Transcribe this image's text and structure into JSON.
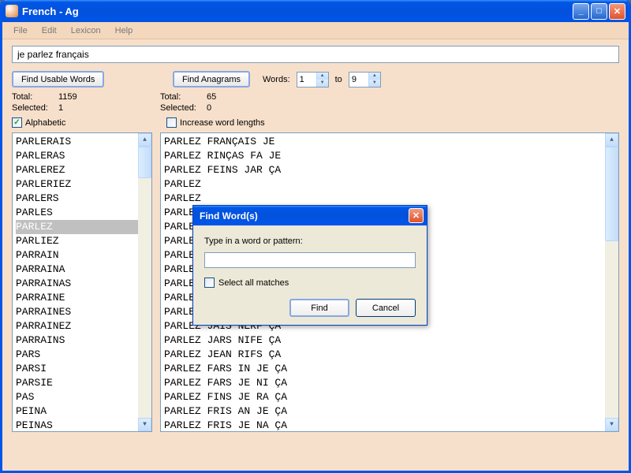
{
  "window": {
    "title": "French - Ag"
  },
  "menu": {
    "file": "File",
    "edit": "Edit",
    "lexicon": "Lexicon",
    "help": "Help"
  },
  "input": {
    "main_value": "je parlez français"
  },
  "buttons": {
    "find_usable": "Find Usable Words",
    "find_anagrams": "Find Anagrams"
  },
  "range": {
    "label": "Words:",
    "from": "1",
    "to_label": "to",
    "to": "9"
  },
  "left_stats": {
    "total_label": "Total:",
    "total": "1159",
    "selected_label": "Selected:",
    "selected": "1"
  },
  "right_stats": {
    "total_label": "Total:",
    "total": "65",
    "selected_label": "Selected:",
    "selected": "0"
  },
  "check": {
    "alphabetic": "Alphabetic",
    "increase": "Increase word lengths"
  },
  "left_list": {
    "items": [
      "PARLERAIS",
      "PARLERAS",
      "PARLEREZ",
      "PARLERIEZ",
      "PARLERS",
      "PARLES",
      "PARLEZ",
      "PARLIEZ",
      "PARRAIN",
      "PARRAINA",
      "PARRAINAS",
      "PARRAINE",
      "PARRAINES",
      "PARRAINEZ",
      "PARRAINS",
      "PARS",
      "PARSI",
      "PARSIE",
      "PAS",
      "PEINA",
      "PEINAS"
    ],
    "selected_index": 6
  },
  "right_list": {
    "items": [
      "PARLEZ FRANÇAIS JE",
      "PARLEZ RINÇAS FA JE",
      "PARLEZ FEINS JAR ÇA",
      "PARLEZ",
      "PARLEZ",
      "PARLEZ",
      "PARLEZ",
      "PARLEZ",
      "PARLEZ",
      "PARLEZ",
      "PARLEZ",
      "PARLEZ",
      "PARLEZ FRIS JEAN ÇA",
      "PARLEZ JAIS NERF ÇA",
      "PARLEZ JARS NIFE ÇA",
      "PARLEZ JEAN RIFS ÇA",
      "PARLEZ FARS IN JE ÇA",
      "PARLEZ FARS JE NI ÇA",
      "PARLEZ FINS JE RA ÇA",
      "PARLEZ FRIS AN JE ÇA",
      "PARLEZ FRIS JE NA ÇA"
    ]
  },
  "dialog": {
    "title": "Find Word(s)",
    "prompt": "Type in a word or pattern:",
    "input_value": "",
    "select_all": "Select all matches",
    "find": "Find",
    "cancel": "Cancel"
  }
}
